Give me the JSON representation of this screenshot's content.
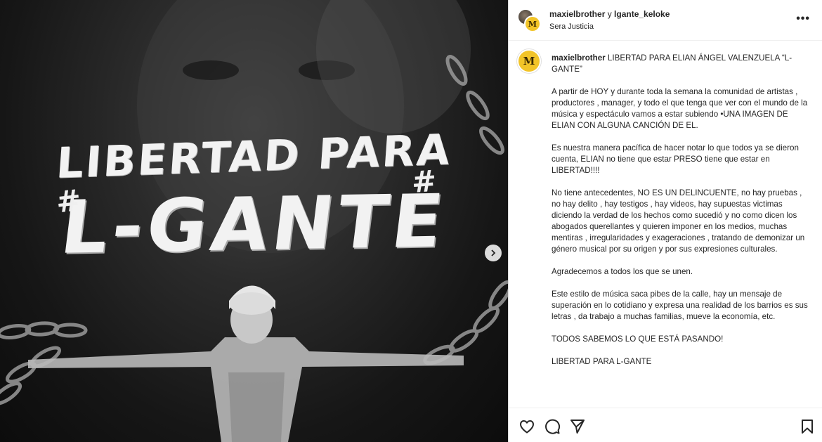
{
  "media": {
    "line1": "LIBERTAD PARA",
    "line2": "L-GANTE",
    "hash_left": "#",
    "hash_right": "#",
    "next_icon": "chevron-right-icon"
  },
  "header": {
    "user1": "maxielbrother",
    "conjunction": " y ",
    "user2": "lgante_keloke",
    "subtitle": "Sera Justicia",
    "more_label": "•••",
    "avatar_letter": "M"
  },
  "caption": {
    "username": "maxielbrother",
    "avatar_letter": "M",
    "headline": "LIBERTAD PARA ELIAN ÁNGEL VALENZUELA “L-GANTE”",
    "paragraphs": [
      "A partir de HOY y durante toda la semana la comunidad de artistas , productores , manager, y todo el que tenga que ver con el mundo de la música y espectáculo vamos a estar subiendo •UNA IMAGEN DE ELIAN CON ALGUNA CANCIÓN DE EL.",
      "Es nuestra manera pacífica de hacer notar lo que todos ya se dieron cuenta, ELIAN no tiene que estar PRESO tiene que estar en LIBERTAD!!!!",
      "No tiene antecedentes, NO ES UN DELINCUENTE, no hay pruebas , no hay delito , hay testigos , hay videos, hay supuestas victimas diciendo la verdad de los hechos como sucedió y no como dicen los abogados querellantes y quieren imponer en los medios, muchas mentiras , irregularidades y exageraciones , tratando de demonizar un género musical por su origen y por sus expresiones culturales.",
      "Agradecemos a todos los que se unen.",
      "Este estilo de música saca pibes de la calle, hay un mensaje de superación en lo cotidiano y expresa una realidad de los barrios es sus letras , da trabajo a muchas familias, mueve la economía, etc.",
      "TODOS SABEMOS LO QUE ESTÁ PASANDO!",
      "LIBERTAD PARA L-GANTE"
    ]
  },
  "actions": {
    "like": "heart-icon",
    "comment": "comment-icon",
    "share": "send-icon",
    "save": "bookmark-icon"
  }
}
